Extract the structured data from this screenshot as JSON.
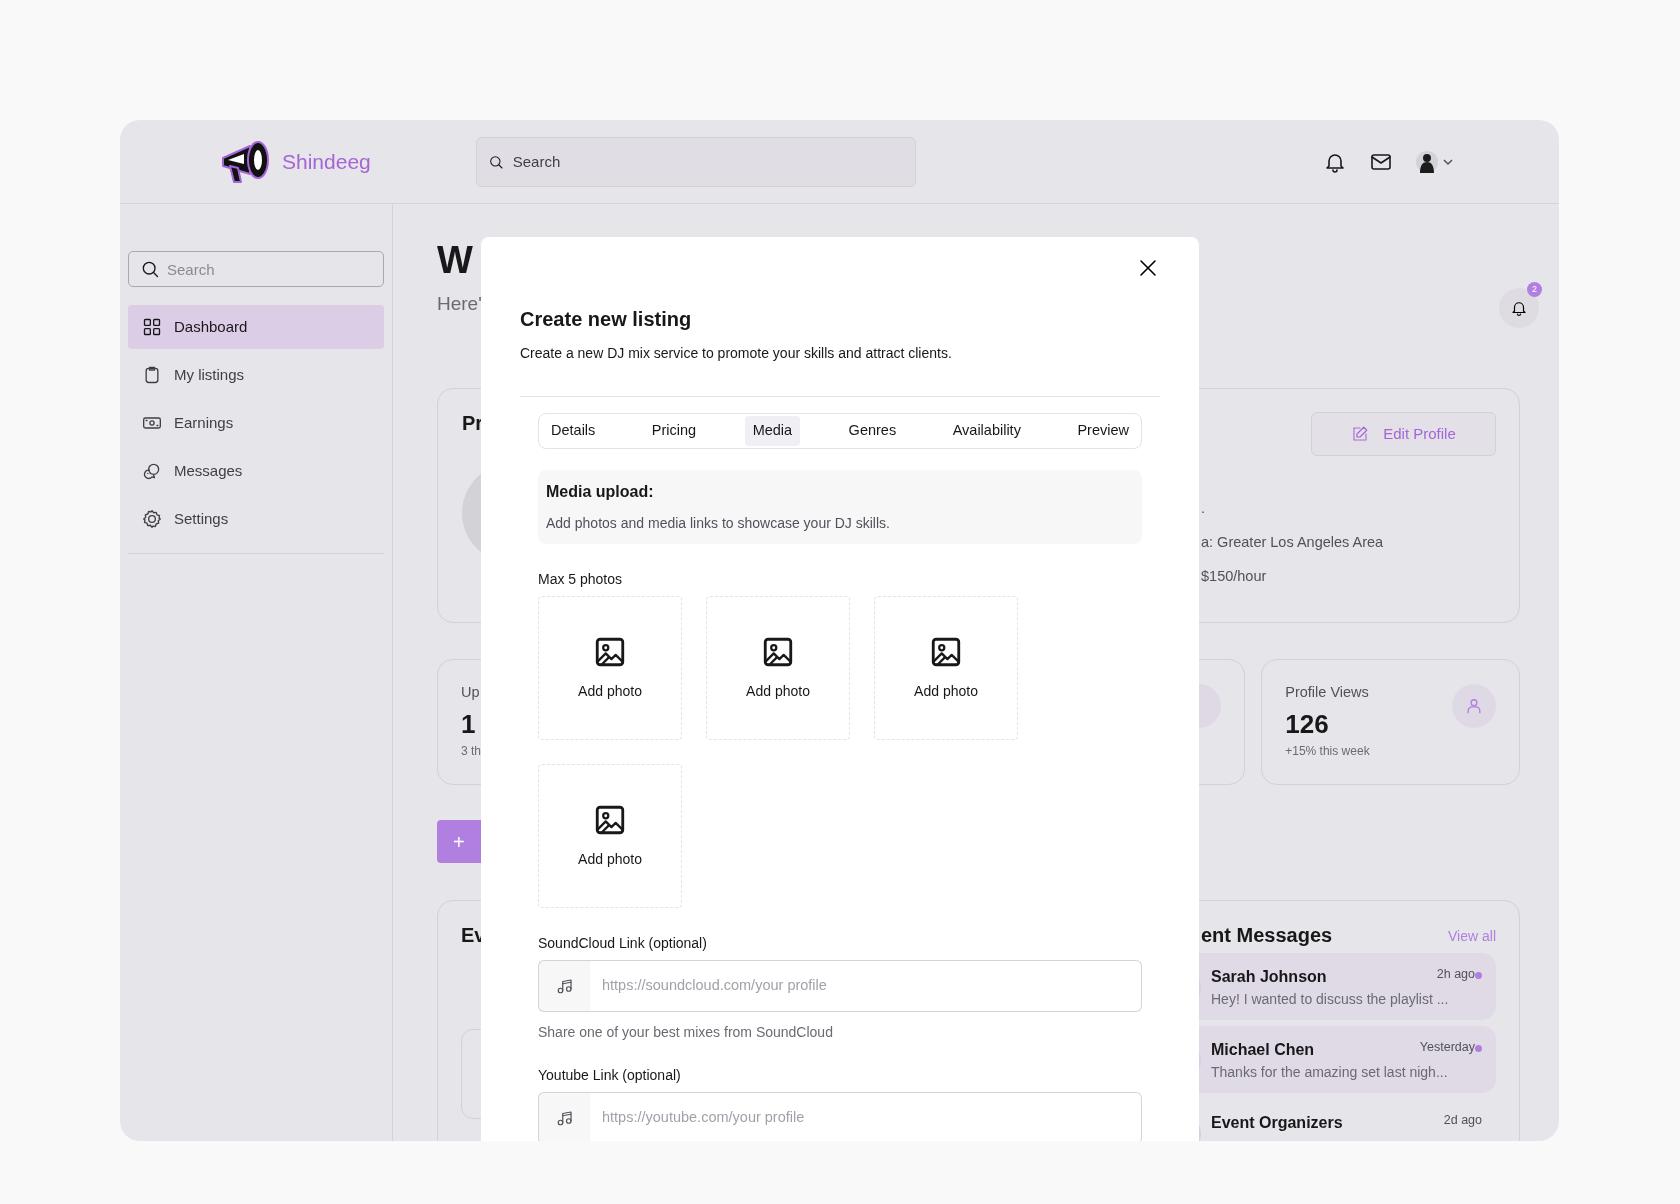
{
  "header": {
    "brand": "Shindeeg",
    "search": {
      "placeholder": "Search"
    }
  },
  "sidebar": {
    "search": {
      "placeholder": "Search"
    },
    "items": [
      {
        "label": "Dashboard",
        "selected": true
      },
      {
        "label": "My listings",
        "selected": false
      },
      {
        "label": "Earnings",
        "selected": false
      },
      {
        "label": "Messages",
        "selected": false
      },
      {
        "label": "Settings",
        "selected": false
      }
    ]
  },
  "main": {
    "title": "W",
    "subtitle": "Here'",
    "notification_count": "2",
    "profile_card": {
      "title": "Pr",
      "edit_button": "Edit Profile",
      "details": [
        ".",
        "a: Greater Los Angeles Area",
        "$150/hour"
      ]
    },
    "stats": [
      {
        "label": "Up",
        "value": "1",
        "note": "3 th"
      },
      {
        "label": "Profile Views",
        "value": "126",
        "note": "+15% this week"
      }
    ],
    "add_button": "+",
    "events_card": {
      "title": "Ev"
    },
    "messages_card": {
      "title": "ent Messages",
      "view_all": "View all",
      "messages": [
        {
          "name": "Sarah Johnson",
          "preview": "Hey! I wanted to discuss the playlist ...",
          "time": "2h ago",
          "unread": true
        },
        {
          "name": "Michael Chen",
          "preview": "Thanks for the amazing set last nigh...",
          "time": "Yesterday",
          "unread": true
        },
        {
          "name": "Event Organizers",
          "time": "2d ago",
          "unread": false
        }
      ]
    }
  },
  "modal": {
    "title": "Create new listing",
    "description": "Create a new DJ mix service to promote your skills and attract clients.",
    "tabs": [
      {
        "label": "Details",
        "selected": false
      },
      {
        "label": "Pricing",
        "selected": false
      },
      {
        "label": "Media",
        "selected": true
      },
      {
        "label": "Genres",
        "selected": false
      },
      {
        "label": "Availability",
        "selected": false
      },
      {
        "label": "Preview",
        "selected": false
      }
    ],
    "section": {
      "title": "Media upload:",
      "description": "Add photos and media links to showcase your DJ skills."
    },
    "photos": {
      "label": "Max 5 photos",
      "slots": [
        "Add photo",
        "Add photo",
        "Add photo",
        "Add photo"
      ]
    },
    "links": [
      {
        "label": "SoundCloud Link (optional)",
        "placeholder": "https://soundcloud.com/your profile",
        "help": "Share one of your best mixes from SoundCloud"
      },
      {
        "label": "Youtube Link (optional)",
        "placeholder": "https://youtube.com/your profile"
      }
    ]
  }
}
